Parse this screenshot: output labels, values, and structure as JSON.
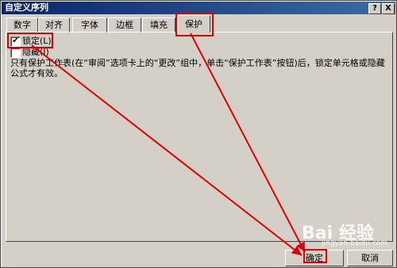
{
  "dialog": {
    "title": "自定义序列",
    "help_btn": "?",
    "close_btn": "X"
  },
  "tabs": [
    {
      "label": "数字"
    },
    {
      "label": "对齐"
    },
    {
      "label": "字体"
    },
    {
      "label": "边框"
    },
    {
      "label": "填充"
    },
    {
      "label": "保护",
      "active": true
    }
  ],
  "protection": {
    "locked_label": "锁定(L)",
    "locked_checked": true,
    "hidden_label": "隐藏(I)",
    "hidden_checked": false,
    "description": "只有保护工作表(在“审阅”选项卡上的“更改”组中，单击“保护工作表”按钮)后，锁定单元格或隐藏公式才有效。"
  },
  "buttons": {
    "ok": "确定",
    "cancel": "取消"
  },
  "watermark": {
    "text": "Bai 经验",
    "sub": "jingyan.baidu.com"
  },
  "colors": {
    "annotation": "#e00000",
    "titlebar": "#0a246a"
  }
}
